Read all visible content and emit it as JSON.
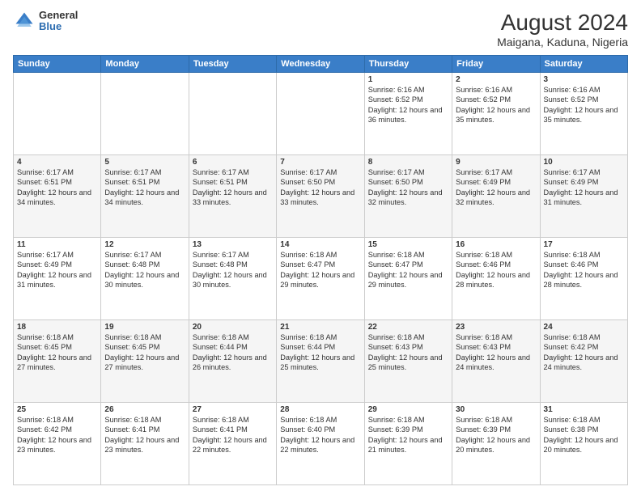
{
  "logo": {
    "general": "General",
    "blue": "Blue"
  },
  "title": "August 2024",
  "subtitle": "Maigana, Kaduna, Nigeria",
  "days_header": [
    "Sunday",
    "Monday",
    "Tuesday",
    "Wednesday",
    "Thursday",
    "Friday",
    "Saturday"
  ],
  "weeks": [
    [
      {
        "num": "",
        "info": ""
      },
      {
        "num": "",
        "info": ""
      },
      {
        "num": "",
        "info": ""
      },
      {
        "num": "",
        "info": ""
      },
      {
        "num": "1",
        "info": "Sunrise: 6:16 AM\nSunset: 6:52 PM\nDaylight: 12 hours and 36 minutes."
      },
      {
        "num": "2",
        "info": "Sunrise: 6:16 AM\nSunset: 6:52 PM\nDaylight: 12 hours and 35 minutes."
      },
      {
        "num": "3",
        "info": "Sunrise: 6:16 AM\nSunset: 6:52 PM\nDaylight: 12 hours and 35 minutes."
      }
    ],
    [
      {
        "num": "4",
        "info": "Sunrise: 6:17 AM\nSunset: 6:51 PM\nDaylight: 12 hours and 34 minutes."
      },
      {
        "num": "5",
        "info": "Sunrise: 6:17 AM\nSunset: 6:51 PM\nDaylight: 12 hours and 34 minutes."
      },
      {
        "num": "6",
        "info": "Sunrise: 6:17 AM\nSunset: 6:51 PM\nDaylight: 12 hours and 33 minutes."
      },
      {
        "num": "7",
        "info": "Sunrise: 6:17 AM\nSunset: 6:50 PM\nDaylight: 12 hours and 33 minutes."
      },
      {
        "num": "8",
        "info": "Sunrise: 6:17 AM\nSunset: 6:50 PM\nDaylight: 12 hours and 32 minutes."
      },
      {
        "num": "9",
        "info": "Sunrise: 6:17 AM\nSunset: 6:49 PM\nDaylight: 12 hours and 32 minutes."
      },
      {
        "num": "10",
        "info": "Sunrise: 6:17 AM\nSunset: 6:49 PM\nDaylight: 12 hours and 31 minutes."
      }
    ],
    [
      {
        "num": "11",
        "info": "Sunrise: 6:17 AM\nSunset: 6:49 PM\nDaylight: 12 hours and 31 minutes."
      },
      {
        "num": "12",
        "info": "Sunrise: 6:17 AM\nSunset: 6:48 PM\nDaylight: 12 hours and 30 minutes."
      },
      {
        "num": "13",
        "info": "Sunrise: 6:17 AM\nSunset: 6:48 PM\nDaylight: 12 hours and 30 minutes."
      },
      {
        "num": "14",
        "info": "Sunrise: 6:18 AM\nSunset: 6:47 PM\nDaylight: 12 hours and 29 minutes."
      },
      {
        "num": "15",
        "info": "Sunrise: 6:18 AM\nSunset: 6:47 PM\nDaylight: 12 hours and 29 minutes."
      },
      {
        "num": "16",
        "info": "Sunrise: 6:18 AM\nSunset: 6:46 PM\nDaylight: 12 hours and 28 minutes."
      },
      {
        "num": "17",
        "info": "Sunrise: 6:18 AM\nSunset: 6:46 PM\nDaylight: 12 hours and 28 minutes."
      }
    ],
    [
      {
        "num": "18",
        "info": "Sunrise: 6:18 AM\nSunset: 6:45 PM\nDaylight: 12 hours and 27 minutes."
      },
      {
        "num": "19",
        "info": "Sunrise: 6:18 AM\nSunset: 6:45 PM\nDaylight: 12 hours and 27 minutes."
      },
      {
        "num": "20",
        "info": "Sunrise: 6:18 AM\nSunset: 6:44 PM\nDaylight: 12 hours and 26 minutes."
      },
      {
        "num": "21",
        "info": "Sunrise: 6:18 AM\nSunset: 6:44 PM\nDaylight: 12 hours and 25 minutes."
      },
      {
        "num": "22",
        "info": "Sunrise: 6:18 AM\nSunset: 6:43 PM\nDaylight: 12 hours and 25 minutes."
      },
      {
        "num": "23",
        "info": "Sunrise: 6:18 AM\nSunset: 6:43 PM\nDaylight: 12 hours and 24 minutes."
      },
      {
        "num": "24",
        "info": "Sunrise: 6:18 AM\nSunset: 6:42 PM\nDaylight: 12 hours and 24 minutes."
      }
    ],
    [
      {
        "num": "25",
        "info": "Sunrise: 6:18 AM\nSunset: 6:42 PM\nDaylight: 12 hours and 23 minutes."
      },
      {
        "num": "26",
        "info": "Sunrise: 6:18 AM\nSunset: 6:41 PM\nDaylight: 12 hours and 23 minutes."
      },
      {
        "num": "27",
        "info": "Sunrise: 6:18 AM\nSunset: 6:41 PM\nDaylight: 12 hours and 22 minutes."
      },
      {
        "num": "28",
        "info": "Sunrise: 6:18 AM\nSunset: 6:40 PM\nDaylight: 12 hours and 22 minutes."
      },
      {
        "num": "29",
        "info": "Sunrise: 6:18 AM\nSunset: 6:39 PM\nDaylight: 12 hours and 21 minutes."
      },
      {
        "num": "30",
        "info": "Sunrise: 6:18 AM\nSunset: 6:39 PM\nDaylight: 12 hours and 20 minutes."
      },
      {
        "num": "31",
        "info": "Sunrise: 6:18 AM\nSunset: 6:38 PM\nDaylight: 12 hours and 20 minutes."
      }
    ]
  ]
}
